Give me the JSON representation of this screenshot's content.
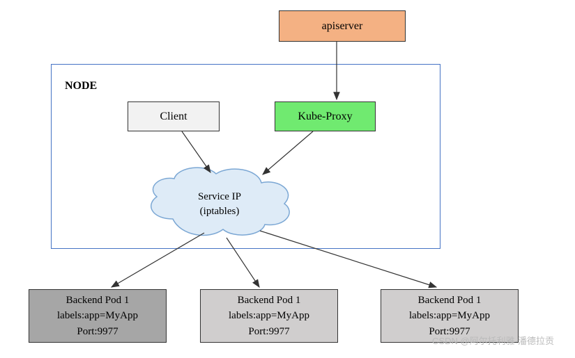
{
  "apiserver": {
    "label": "apiserver"
  },
  "node": {
    "label": "NODE"
  },
  "client": {
    "label": "Client"
  },
  "kubeproxy": {
    "label": "Kube-Proxy"
  },
  "serviceip": {
    "line1": "Service IP",
    "line2": "(iptables)"
  },
  "pods": [
    {
      "title": "Backend Pod 1",
      "labels": "labels:app=MyApp",
      "port": "Port:9977"
    },
    {
      "title": "Backend Pod 1",
      "labels": "labels:app=MyApp",
      "port": "Port:9977"
    },
    {
      "title": "Backend Pod 1",
      "labels": "labels:app=MyApp",
      "port": "Port:9977"
    }
  ],
  "watermark": "CSDN @阿尔托利雅·潘德拉贡"
}
